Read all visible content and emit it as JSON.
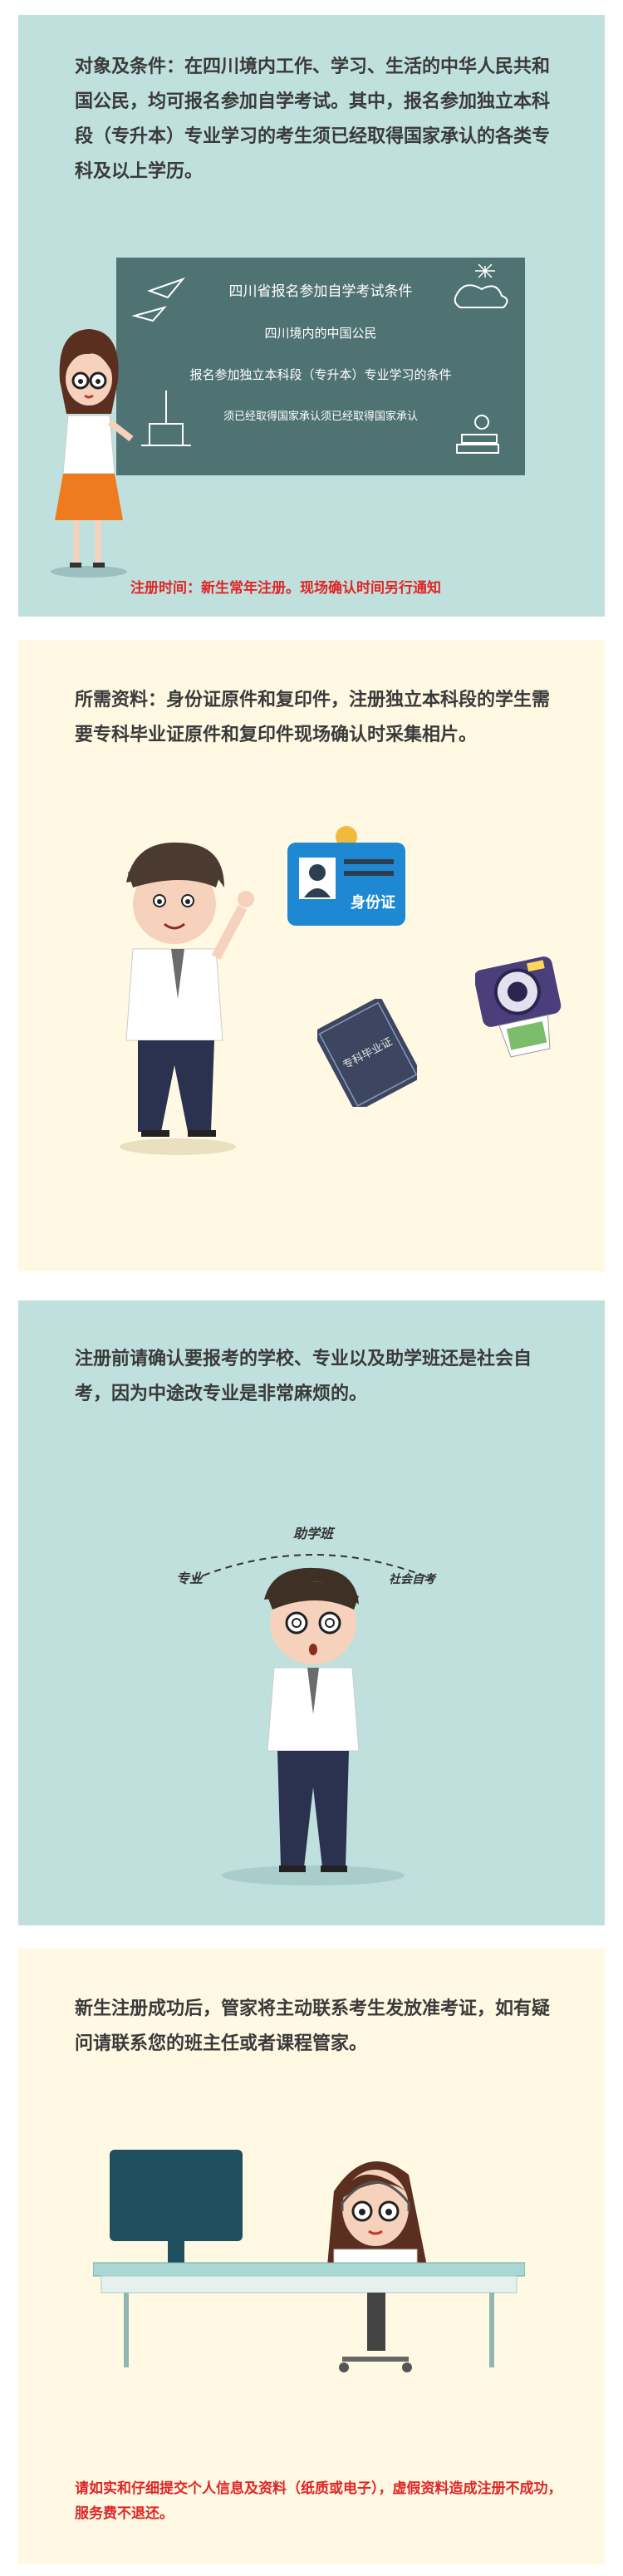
{
  "sections": [
    {
      "text": "对象及条件：在四川境内工作、学习、生活的中华人民共和国公民，均可报名参加自学考试。其中，报名参加独立本科段（专升本）专业学习的考生须已经取得国家承认的各类专科及以上学历。",
      "board": {
        "title": "四川省报名参加自学考试条件",
        "line1": "四川境内的中国公民",
        "line2": "报名参加独立本科段（专升本）专业学习的条件",
        "line3": "须已经取得国家承认须已经取得国家承认"
      },
      "note": "注册时间：新生常年注册。现场确认时间另行通知"
    },
    {
      "text": "所需资料：身份证原件和复印件，注册独立本科段的学生需要专科毕业证原件和复印件现场确认时采集相片。",
      "id_card_label": "身份证",
      "diploma_label": "专科毕业证"
    },
    {
      "text": "注册前请确认要报考的学校、专业以及助学班还是社会自考，因为中途改专业是非常麻烦的。",
      "thought_labels": [
        "专业",
        "助学班",
        "社会自考"
      ]
    },
    {
      "text": "新生注册成功后，管家将主动联系考生发放准考证，如有疑问请联系您的班主任或者课程管家。",
      "warning": "请如实和仔细提交个人信息及资料（纸质或电子），虚假资料造成注册不成功，服务费不退还。"
    }
  ],
  "colors": {
    "teal_panel": "#bfe0dd",
    "cream_panel": "#fff8e3",
    "board": "#4f7373",
    "alert_red": "#e02424"
  }
}
